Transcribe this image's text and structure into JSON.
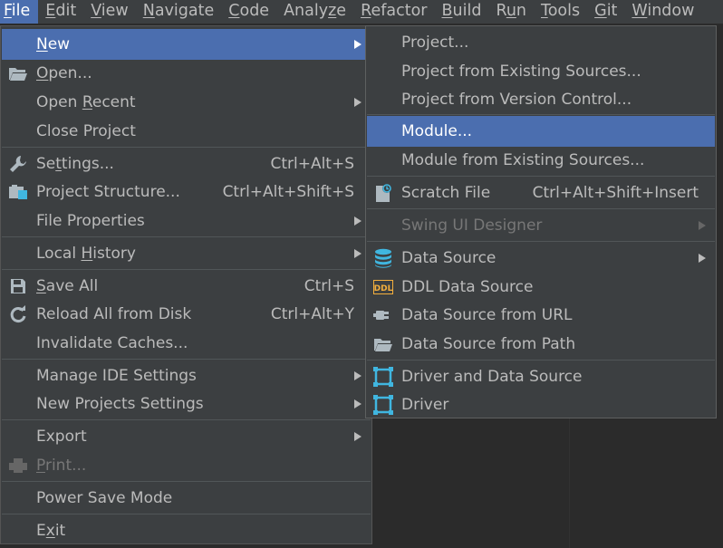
{
  "menubar": {
    "items": [
      {
        "label": "File",
        "mnemonic": "F",
        "rest": "ile"
      },
      {
        "label": "Edit",
        "mnemonic": "E",
        "rest": "dit"
      },
      {
        "label": "View",
        "mnemonic": "V",
        "rest": "iew"
      },
      {
        "label": "Navigate",
        "mnemonic": "N",
        "rest": "avigate"
      },
      {
        "label": "Code",
        "mnemonic": "C",
        "rest": "ode"
      },
      {
        "label": "Analyze",
        "mnemonic": "z",
        "pre": "Analy",
        "rest": "e"
      },
      {
        "label": "Refactor",
        "mnemonic": "R",
        "rest": "efactor"
      },
      {
        "label": "Build",
        "mnemonic": "B",
        "rest": "uild"
      },
      {
        "label": "Run",
        "mnemonic": "u",
        "pre": "R",
        "rest": "n"
      },
      {
        "label": "Tools",
        "mnemonic": "T",
        "rest": "ools"
      },
      {
        "label": "Git",
        "mnemonic": "G",
        "rest": "it"
      },
      {
        "label": "Window",
        "mnemonic": "W",
        "rest": "indow"
      }
    ]
  },
  "file_menu": {
    "new": {
      "mnemonic": "N",
      "rest": "ew"
    },
    "open": {
      "mnemonic": "O",
      "rest": "pen..."
    },
    "open_recent": {
      "pre": "Open ",
      "mnemonic": "R",
      "rest": "ecent"
    },
    "close_project": "Close Project",
    "settings": {
      "pre": "Se",
      "mnemonic": "t",
      "rest": "tings...",
      "shortcut": "Ctrl+Alt+S"
    },
    "project_structure": {
      "label": "Project Structure...",
      "shortcut": "Ctrl+Alt+Shift+S"
    },
    "file_properties": "File Properties",
    "local_history": {
      "pre": "Local ",
      "mnemonic": "H",
      "rest": "istory"
    },
    "save_all": {
      "mnemonic": "S",
      "rest": "ave All",
      "shortcut": "Ctrl+S"
    },
    "reload": {
      "label": "Reload All from Disk",
      "shortcut": "Ctrl+Alt+Y"
    },
    "invalidate": "Invalidate Caches...",
    "manage_ide": "Manage IDE Settings",
    "new_projects_settings": "New Projects Settings",
    "export": "Export",
    "print": {
      "mnemonic": "P",
      "rest": "rint..."
    },
    "power_save": "Power Save Mode",
    "exit": {
      "pre": "E",
      "mnemonic": "x",
      "rest": "it"
    }
  },
  "new_submenu": {
    "project": "Project...",
    "project_existing": "Project from Existing Sources...",
    "project_vcs": "Project from Version Control...",
    "module": "Module...",
    "module_existing": "Module from Existing Sources...",
    "scratch": {
      "label": "Scratch File",
      "shortcut": "Ctrl+Alt+Shift+Insert"
    },
    "swing": "Swing UI Designer",
    "data_source": "Data Source",
    "ddl_data_source": "DDL Data Source",
    "ddl_icon_text": "DDL",
    "ds_url": "Data Source from URL",
    "ds_path": "Data Source from Path",
    "driver_ds": "Driver and Data Source",
    "driver": "Driver"
  },
  "colors": {
    "menu_bg": "#3c3f41",
    "selection": "#4b6eaf",
    "text": "#bbbbbb",
    "disabled": "#777777",
    "db_icon": "#40b6e0",
    "ddl_icon": "#f4af3d"
  }
}
